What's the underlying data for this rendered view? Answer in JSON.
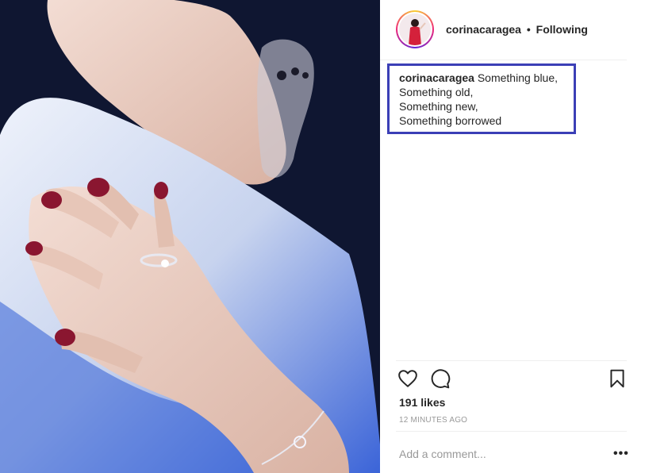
{
  "post": {
    "author": "corinacaragea",
    "separator": "•",
    "follow_status": "Following",
    "caption_user": "corinacaragea",
    "caption_lines": [
      "Something blue,",
      "Something old,",
      "Something new,",
      "Something borrowed"
    ],
    "likes": "191 likes",
    "timestamp": "12 MINUTES AGO"
  },
  "comment": {
    "placeholder": "Add a comment..."
  },
  "more_label": "•••",
  "icons": {
    "like": "heart-icon",
    "comment": "comment-icon",
    "save": "bookmark-icon"
  },
  "colors": {
    "highlight_box": "#3b3fb6",
    "muted": "#999999",
    "text": "#262626"
  }
}
